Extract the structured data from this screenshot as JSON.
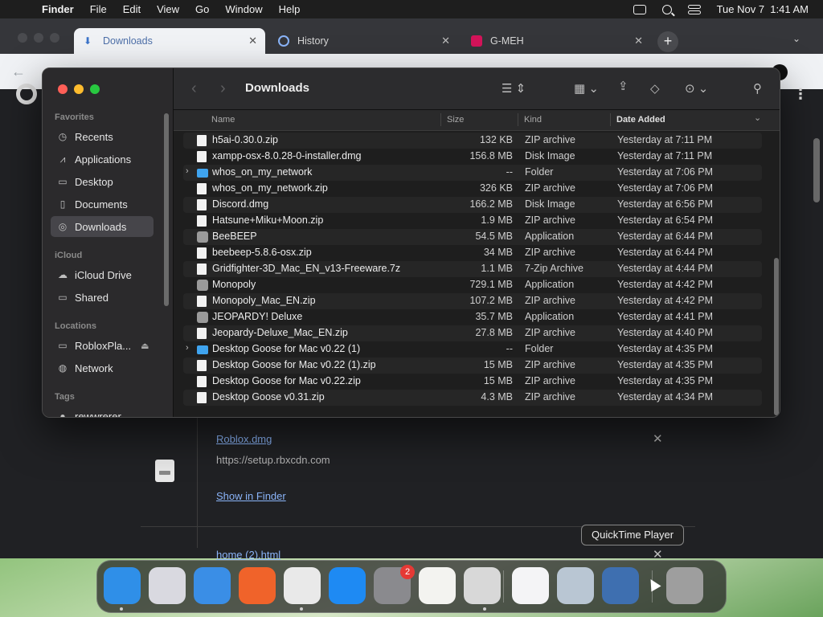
{
  "menubar": {
    "app_name": "Finder",
    "items": [
      "File",
      "Edit",
      "View",
      "Go",
      "Window",
      "Help"
    ],
    "datetime": "Tue Nov 7  1:41 AM"
  },
  "browser": {
    "tabs": [
      {
        "label": "Downloads",
        "icon": "download-icon",
        "active": true
      },
      {
        "label": "History",
        "icon": "history-icon",
        "active": false
      },
      {
        "label": "G-MEH",
        "icon": "site-favicon",
        "active": false
      }
    ],
    "new_tab_label": "+",
    "downloads": {
      "item1": {
        "name": "Roblox.dmg",
        "url": "https://setup.rbxcdn.com",
        "action": "Show in Finder"
      },
      "item2": {
        "name": "home (2).html"
      }
    }
  },
  "finder": {
    "title": "Downloads",
    "sidebar": {
      "favorites_label": "Favorites",
      "favorites": [
        {
          "label": "Recents",
          "icon": "clock-icon"
        },
        {
          "label": "Applications",
          "icon": "applications-icon"
        },
        {
          "label": "Desktop",
          "icon": "desktop-icon"
        },
        {
          "label": "Documents",
          "icon": "document-icon"
        },
        {
          "label": "Downloads",
          "icon": "downloads-icon",
          "selected": true
        }
      ],
      "icloud_label": "iCloud",
      "icloud": [
        {
          "label": "iCloud Drive",
          "icon": "cloud-icon"
        },
        {
          "label": "Shared",
          "icon": "shared-folder-icon"
        }
      ],
      "locations_label": "Locations",
      "locations": [
        {
          "label": "RobloxPla...",
          "icon": "disk-icon"
        },
        {
          "label": "Network",
          "icon": "globe-icon"
        }
      ],
      "tags_label": "Tags",
      "tags": [
        {
          "label": "rewwrerer"
        }
      ]
    },
    "columns": {
      "name": "Name",
      "size": "Size",
      "kind": "Kind",
      "date": "Date Added"
    },
    "files": [
      {
        "name": "h5ai-0.30.0.zip",
        "size": "132 KB",
        "kind": "ZIP archive",
        "date": "Yesterday at 7:11 PM",
        "type": "doc"
      },
      {
        "name": "xampp-osx-8.0.28-0-installer.dmg",
        "size": "156.8 MB",
        "kind": "Disk Image",
        "date": "Yesterday at 7:11 PM",
        "type": "doc"
      },
      {
        "name": "whos_on_my_network",
        "size": "--",
        "kind": "Folder",
        "date": "Yesterday at 7:06 PM",
        "type": "folder"
      },
      {
        "name": "whos_on_my_network.zip",
        "size": "326 KB",
        "kind": "ZIP archive",
        "date": "Yesterday at 7:06 PM",
        "type": "doc"
      },
      {
        "name": "Discord.dmg",
        "size": "166.2 MB",
        "kind": "Disk Image",
        "date": "Yesterday at 6:56 PM",
        "type": "doc"
      },
      {
        "name": "Hatsune+Miku+Moon.zip",
        "size": "1.9 MB",
        "kind": "ZIP archive",
        "date": "Yesterday at 6:54 PM",
        "type": "doc"
      },
      {
        "name": "BeeBEEP",
        "size": "54.5 MB",
        "kind": "Application",
        "date": "Yesterday at 6:44 PM",
        "type": "app"
      },
      {
        "name": "beebeep-5.8.6-osx.zip",
        "size": "34 MB",
        "kind": "ZIP archive",
        "date": "Yesterday at 6:44 PM",
        "type": "doc"
      },
      {
        "name": "Gridfighter-3D_Mac_EN_v13-Freeware.7z",
        "size": "1.1 MB",
        "kind": "7-Zip Archive",
        "date": "Yesterday at 4:44 PM",
        "type": "doc"
      },
      {
        "name": "Monopoly",
        "size": "729.1 MB",
        "kind": "Application",
        "date": "Yesterday at 4:42 PM",
        "type": "app"
      },
      {
        "name": "Monopoly_Mac_EN.zip",
        "size": "107.2 MB",
        "kind": "ZIP archive",
        "date": "Yesterday at 4:42 PM",
        "type": "doc"
      },
      {
        "name": "JEOPARDY! Deluxe",
        "size": "35.7 MB",
        "kind": "Application",
        "date": "Yesterday at 4:41 PM",
        "type": "app"
      },
      {
        "name": "Jeopardy-Deluxe_Mac_EN.zip",
        "size": "27.8 MB",
        "kind": "ZIP archive",
        "date": "Yesterday at 4:40 PM",
        "type": "doc"
      },
      {
        "name": "Desktop Goose for Mac v0.22 (1)",
        "size": "--",
        "kind": "Folder",
        "date": "Yesterday at 4:35 PM",
        "type": "folder"
      },
      {
        "name": "Desktop Goose for Mac v0.22 (1).zip",
        "size": "15 MB",
        "kind": "ZIP archive",
        "date": "Yesterday at 4:35 PM",
        "type": "doc"
      },
      {
        "name": "Desktop Goose for Mac v0.22.zip",
        "size": "15 MB",
        "kind": "ZIP archive",
        "date": "Yesterday at 4:35 PM",
        "type": "doc"
      },
      {
        "name": "Desktop Goose v0.31.zip",
        "size": "4.3 MB",
        "kind": "ZIP archive",
        "date": "Yesterday at 4:34 PM",
        "type": "doc"
      }
    ]
  },
  "tooltip": "QuickTime Player",
  "dock": {
    "items": [
      {
        "name": "finder",
        "color": "#2f8fe8"
      },
      {
        "name": "launchpad",
        "color": "#d9d9e0"
      },
      {
        "name": "safari",
        "color": "#3a8ee6"
      },
      {
        "name": "firefox",
        "color": "#f0632a"
      },
      {
        "name": "chrome",
        "color": "#e9e9e9"
      },
      {
        "name": "app-store",
        "color": "#1e8af3"
      },
      {
        "name": "system-settings",
        "color": "#8a8a8e"
      },
      {
        "name": "textedit",
        "color": "#f3f3f0"
      },
      {
        "name": "roblox",
        "color": "#d8d8d8"
      },
      {
        "name": "visual-studio",
        "color": "#f4f4f6"
      },
      {
        "name": "preview",
        "color": "#b9c6d3"
      },
      {
        "name": "quicktime-player",
        "color": "#3e6fb0"
      },
      {
        "name": "trash",
        "color": "#9e9e9e"
      }
    ],
    "settings_badge": "2"
  }
}
